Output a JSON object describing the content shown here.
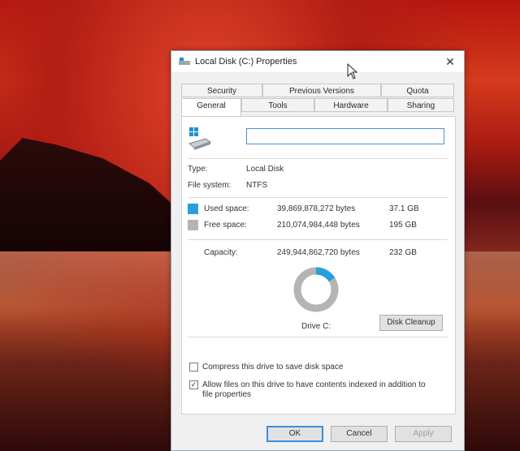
{
  "window": {
    "title": "Local Disk (C:) Properties",
    "close_glyph": "✕"
  },
  "tabs_top": [
    "Security",
    "Previous Versions",
    "Quota"
  ],
  "tabs_bottom": [
    "General",
    "Tools",
    "Hardware",
    "Sharing"
  ],
  "active_tab": "General",
  "drive_name_value": "",
  "type_label": "Type:",
  "type_value": "Local Disk",
  "fs_label": "File system:",
  "fs_value": "NTFS",
  "used": {
    "label": "Used space:",
    "bytes": "39,869,878,272 bytes",
    "size": "37.1 GB",
    "color": "#26a0da"
  },
  "free": {
    "label": "Free space:",
    "bytes": "210,074,984,448 bytes",
    "size": "195 GB",
    "color": "#b4b4b4"
  },
  "capacity": {
    "label": "Capacity:",
    "bytes": "249,944,862,720 bytes",
    "size": "232 GB"
  },
  "used_fraction": 0.16,
  "drive_caption": "Drive C:",
  "disk_cleanup_label": "Disk Cleanup",
  "compress_label": "Compress this drive to save disk space",
  "compress_checked": false,
  "index_label_line1": "Allow files on this drive to have contents indexed in addition to",
  "index_label_line2": "file properties",
  "index_checked": true,
  "buttons": {
    "ok": "OK",
    "cancel": "Cancel",
    "apply": "Apply"
  },
  "icons": {
    "title": "drive-icon",
    "close": "close-icon",
    "drive": "windows-drive-icon",
    "check": "checkmark-icon"
  }
}
